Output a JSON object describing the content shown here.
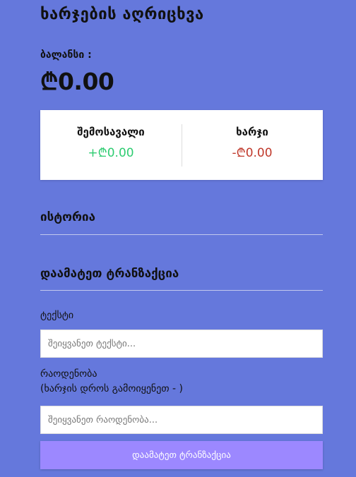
{
  "app": {
    "title": "ხარჯების აღრიცხვა"
  },
  "balance": {
    "label": "ბალანსი :",
    "value": "₾0.00"
  },
  "summary": {
    "income": {
      "label": "შემოსავალი",
      "value": "+₾0.00"
    },
    "expense": {
      "label": "ხარჯი",
      "value": "-₾0.00"
    },
    "colors": {
      "income": "#2ecc71",
      "expense": "#c0392b"
    }
  },
  "history": {
    "title": "ისტორია"
  },
  "form": {
    "title": "დაამატეთ ტრანზაქცია",
    "text_label": "ტექსტი",
    "text_placeholder": "შეიყვანეთ ტექსტი...",
    "amount_label": "რაოდენობა",
    "amount_hint": "(ხარჯის დროს გამოიყენეთ - )",
    "amount_placeholder": "შეიყვანეთ რაოდენობა...",
    "submit_label": "დაამატეთ ტრანზაქცია"
  },
  "theme": {
    "background": "#6578dc",
    "button": "#9c88ff"
  }
}
